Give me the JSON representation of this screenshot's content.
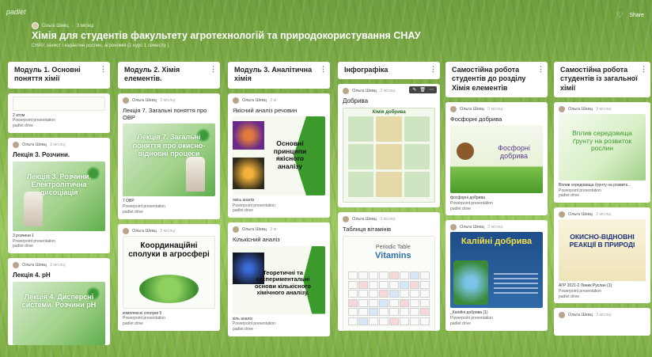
{
  "app": {
    "brand": "padlet"
  },
  "header": {
    "author": "Ольга Шевц",
    "posted": "3 місяці",
    "title": "Хімія для студентів факультету агротехнологій та природокористування СНАУ",
    "subtitle": "СНАУ, захист і карантин рослин, агрономія (1 курс 1 семестр )",
    "actions": {
      "share_label": "Share"
    }
  },
  "colors": {
    "accent": "#3c9a2d",
    "header_text": "#ffffff"
  },
  "columns": [
    {
      "title": "Модуль 1. Основні поняття хімії",
      "cards": [
        {
          "caption": "2 атом",
          "type_label": "Powerpoint presentation",
          "source": "padlet drive"
        },
        {
          "author": "Ольга Шевц",
          "time": "3 місяці",
          "title": "Лекція 3. Розчини.",
          "slide_text": "Лекція 3. Розчини. Електролітична дисоціація",
          "caption": "3 розчини 1",
          "type_label": "Powerpoint presentation",
          "source": "padlet drive"
        },
        {
          "author": "Ольга Шевц",
          "time": "3 місяці",
          "title": "Лекція 4. pH",
          "slide_text": "Лекція 4. Дисперсні системи. Розчини pH"
        }
      ]
    },
    {
      "title": "Модуль 2. Хімія елементів.",
      "cards": [
        {
          "author": "Ольга Шевц",
          "time": "3 місяці",
          "title": "Лекція 7. Загальні поняття про ОВР",
          "slide_text": "Лекція 7. Загальні поняття про окисно-відновні процеси",
          "caption": "7 ОВР",
          "type_label": "Powerpoint presentation",
          "source": "padlet drive"
        },
        {
          "author": "Ольга Шевц",
          "time": "3 місяці",
          "slide_text": "Координаційні сполуки в агросфері",
          "caption": "комплексні сполуки 5",
          "type_label": "Powerpoint presentation",
          "source": "padlet drive"
        }
      ]
    },
    {
      "title": "Модуль 3. Аналітична хімія",
      "cards": [
        {
          "author": "Ольга Шевц",
          "time": "3 м",
          "title": "Якісний аналіз речовин",
          "slide_text": "Основні принципи якісного аналізу",
          "caption": "якісь аналіз",
          "type_label": "Powerpoint presentation",
          "source": "padlet drive"
        },
        {
          "author": "Ольга Шевц",
          "time": "3 м",
          "title": "Кількісний аналіз",
          "slide_text": "Теоретичні та експериментальні основи кількісного хімічного аналізу.",
          "caption": "кіль аналіз",
          "type_label": "Powerpoint presentation",
          "source": "padlet drive"
        }
      ]
    },
    {
      "title": "Інфографіка",
      "cards": [
        {
          "author": "Ольга Шевц",
          "time": "3 місяці",
          "title": "Добрива",
          "slide_text": "Хімія добрива"
        },
        {
          "author": "Ольга Шевц",
          "time": "3 місяці",
          "title": "Таблиця вітамінів",
          "slide_sub": "Periodic Table",
          "slide_text": "Vitamins"
        }
      ]
    },
    {
      "title": "Самостійна робота студентів до розділу Хімія елементів",
      "cards": [
        {
          "author": "Ольга Шевц",
          "time": "3 місяці",
          "title": "Фосфорні добрива",
          "slide_text": "Фосфорні добрива",
          "caption": "фосфорні добрива",
          "type_label": "Powerpoint presentation",
          "source": "padlet drive"
        },
        {
          "author": "Ольга Шевц",
          "time": "3 місяці",
          "slide_text": "Калійні добрива",
          "caption": "_Калійні добрива (1)",
          "type_label": "Powerpoint presentation",
          "source": "padlet drive"
        }
      ]
    },
    {
      "title": "Самостійна робота студентів із загальної хімії",
      "cards": [
        {
          "author": "Ольга Шевц",
          "time": "3 місяці",
          "slide_text": "Вплив середовища ґрунту на розвиток рослин",
          "caption": "Вплив середовища ґрунту на розвитк...",
          "type_label": "Powerpoint presentation",
          "source": "padlet drive"
        },
        {
          "author": "Ольга Шевц",
          "time": "3 місяці",
          "slide_text": "ОКИСНО-ВІДНОВНІ РЕАКЦІЇ В ПРИРОДІ",
          "caption": "АГР 2021-2 Линик Руслан (1)",
          "type_label": "Powerpoint presentation",
          "source": "padlet drive"
        },
        {
          "author": "Ольга Шевц",
          "time": "3 місяці"
        }
      ]
    }
  ]
}
